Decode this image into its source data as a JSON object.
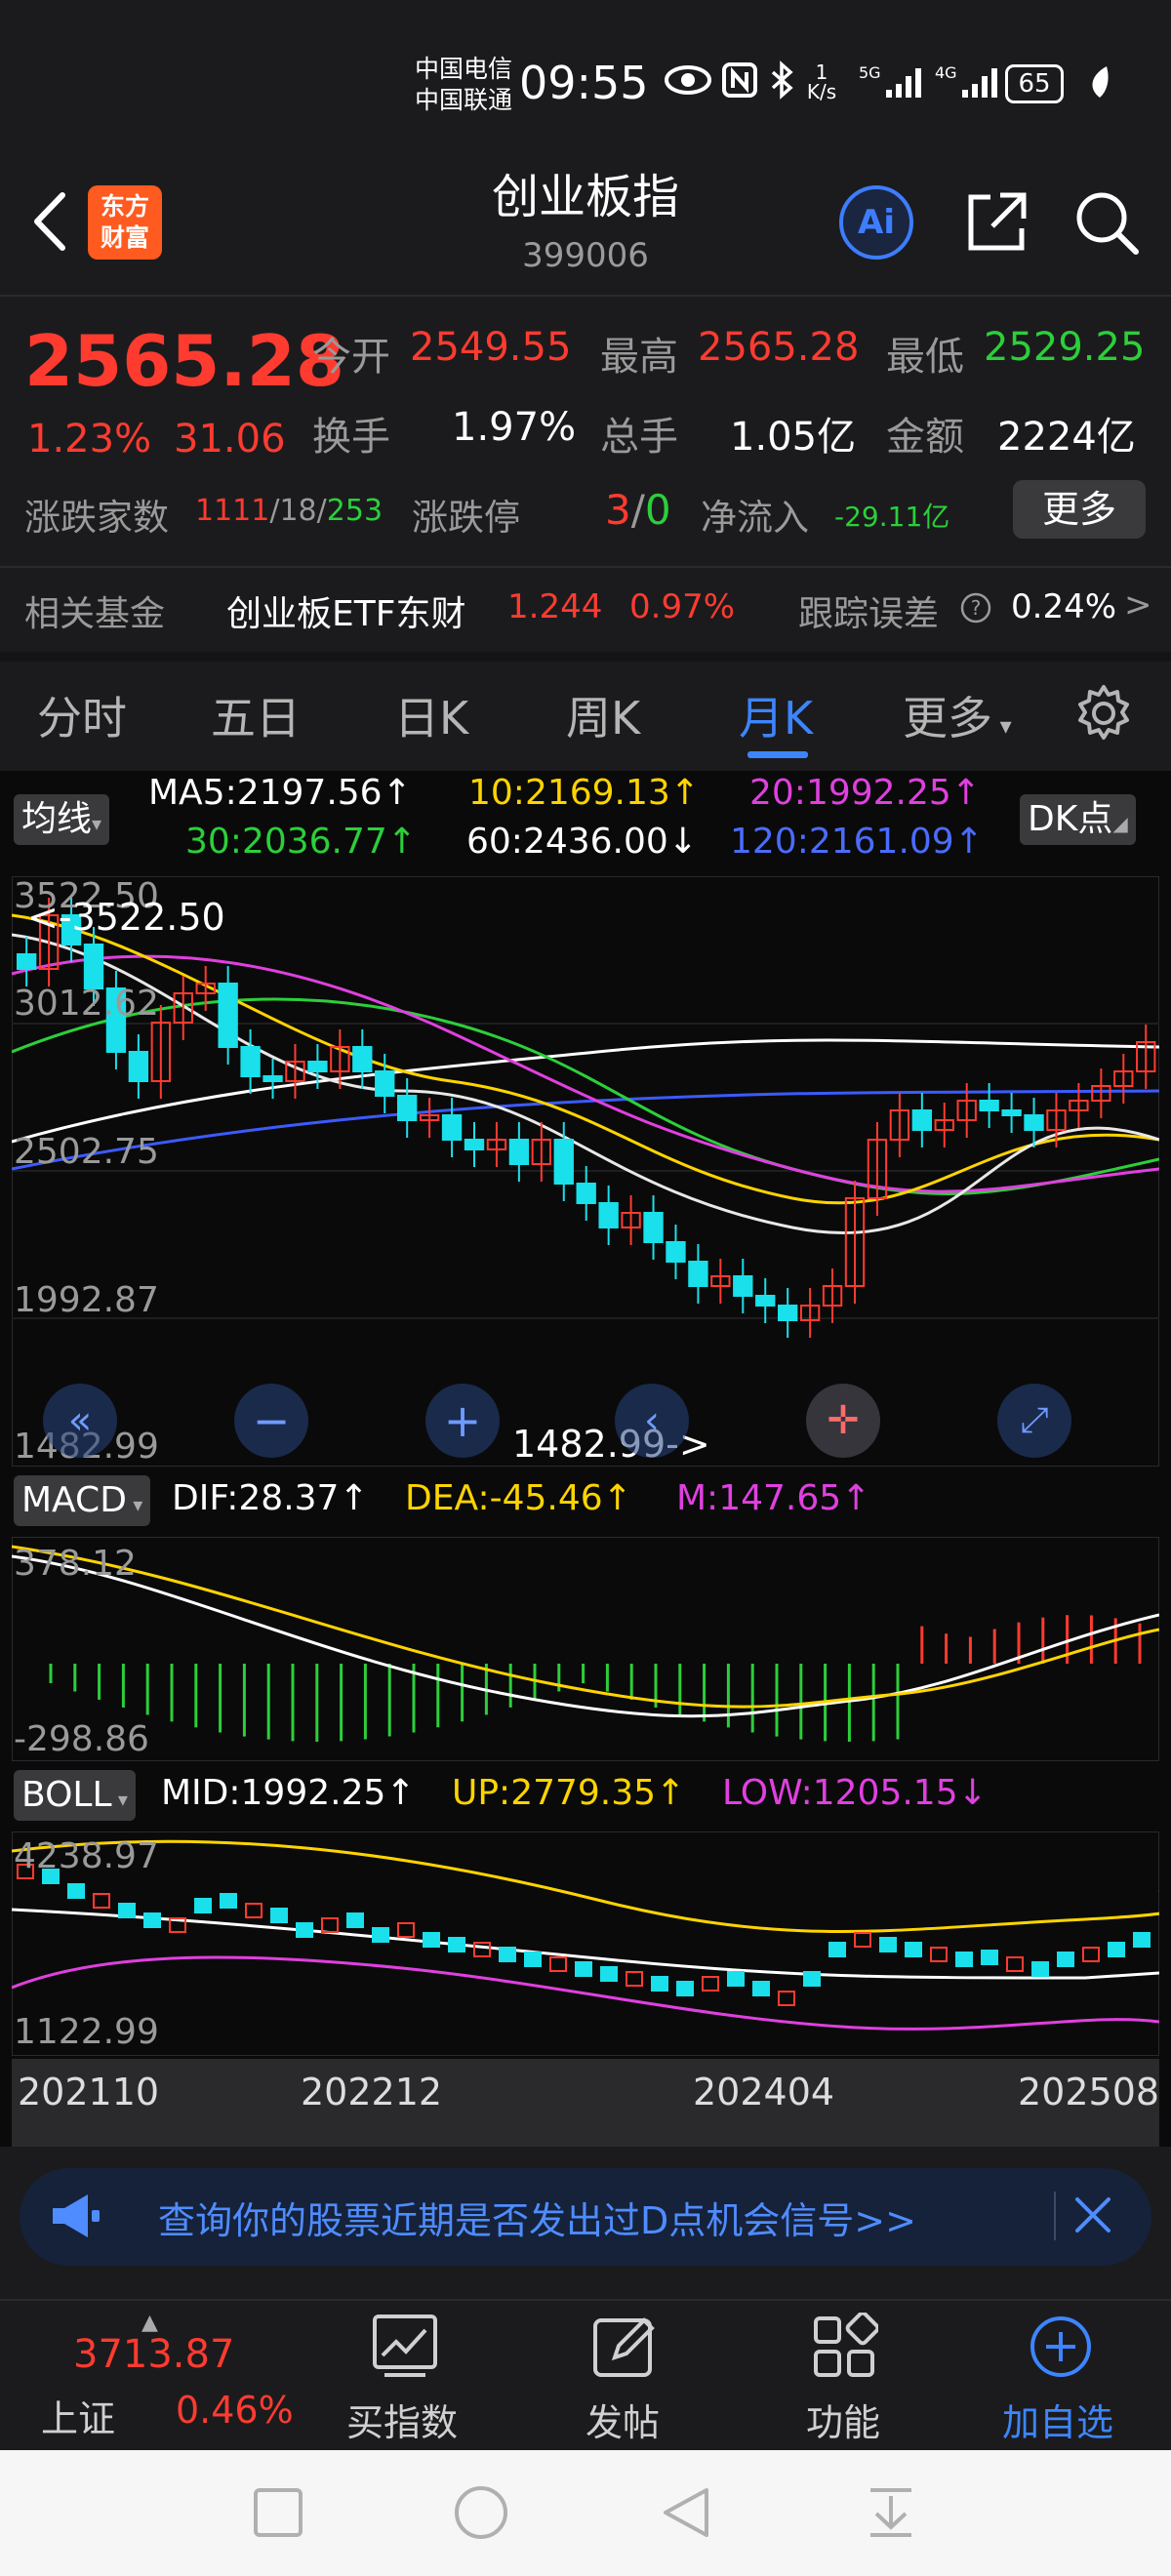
{
  "status": {
    "carrier1": "中国电信",
    "carrier2": "中国联通",
    "time": "09:55",
    "net_speed": "1 K/s",
    "battery": "65"
  },
  "header": {
    "logo_line1": "东方",
    "logo_line2": "财富",
    "title": "创业板指",
    "code": "399006",
    "ai_label": "Ai"
  },
  "quote": {
    "price": "2565.28",
    "change_pct": "1.23%",
    "change": "31.06",
    "open_label": "今开",
    "open": "2549.55",
    "high_label": "最高",
    "high": "2565.28",
    "low_label": "最低",
    "low": "2529.25",
    "turnover_label": "换手",
    "turnover": "1.97%",
    "volume_label": "总手",
    "volume": "1.05亿",
    "amount_label": "金额",
    "amount": "2224亿",
    "breadth_label": "涨跌家数",
    "up": "1111",
    "flat": "18",
    "down": "253",
    "limit_label": "涨跌停",
    "limit_up": "3",
    "limit_down": "0",
    "inflow_label": "净流入",
    "inflow": "-29.11亿",
    "more": "更多"
  },
  "fund": {
    "label": "相关基金",
    "name": "创业板ETF东财",
    "price": "1.244",
    "pct": "0.97%",
    "err_label": "跟踪误差",
    "err": "0.24%"
  },
  "tabs": [
    "分时",
    "五日",
    "日K",
    "周K",
    "月K",
    "更多"
  ],
  "active_tab": 4,
  "ma": {
    "chip": "均线",
    "ma5": "MA5:2197.56↑",
    "ma10": "10:2169.13↑",
    "ma20": "20:1992.25↑",
    "ma30": "30:2036.77↑",
    "ma60": "60:2436.00↓",
    "ma120": "120:2161.09↑",
    "dk": "DK点",
    "y_labels": [
      "3522.50",
      "3012.62",
      "2502.75",
      "1992.87",
      "1482.99"
    ],
    "max_note": "3522.50",
    "min_note": "1482.99->"
  },
  "macd": {
    "chip": "MACD",
    "dif": "DIF:28.37↑",
    "dea": "DEA:-45.46↑",
    "m": "M:147.65↑",
    "y_top": "378.12",
    "y_bottom": "-298.86"
  },
  "boll": {
    "chip": "BOLL",
    "mid": "MID:1992.25↑",
    "up": "UP:2779.35↑",
    "low": "LOW:1205.15↓",
    "y_top": "4238.97",
    "y_bottom": "1122.99"
  },
  "x_axis": [
    "202110",
    "202212",
    "202404",
    "202508"
  ],
  "banner": {
    "text": "查询你的股票近期是否发出过D点机会信号>>"
  },
  "bottom_nav": {
    "index_value": "3713.87",
    "index_name": "上证",
    "index_pct": "0.46%",
    "items": [
      "买指数",
      "发帖",
      "功能",
      "加自选"
    ]
  },
  "colors": {
    "up": "#ff3b30",
    "down": "#2ccf3a",
    "accent": "#3d85ff",
    "candle_down": "#19e0ea"
  }
}
